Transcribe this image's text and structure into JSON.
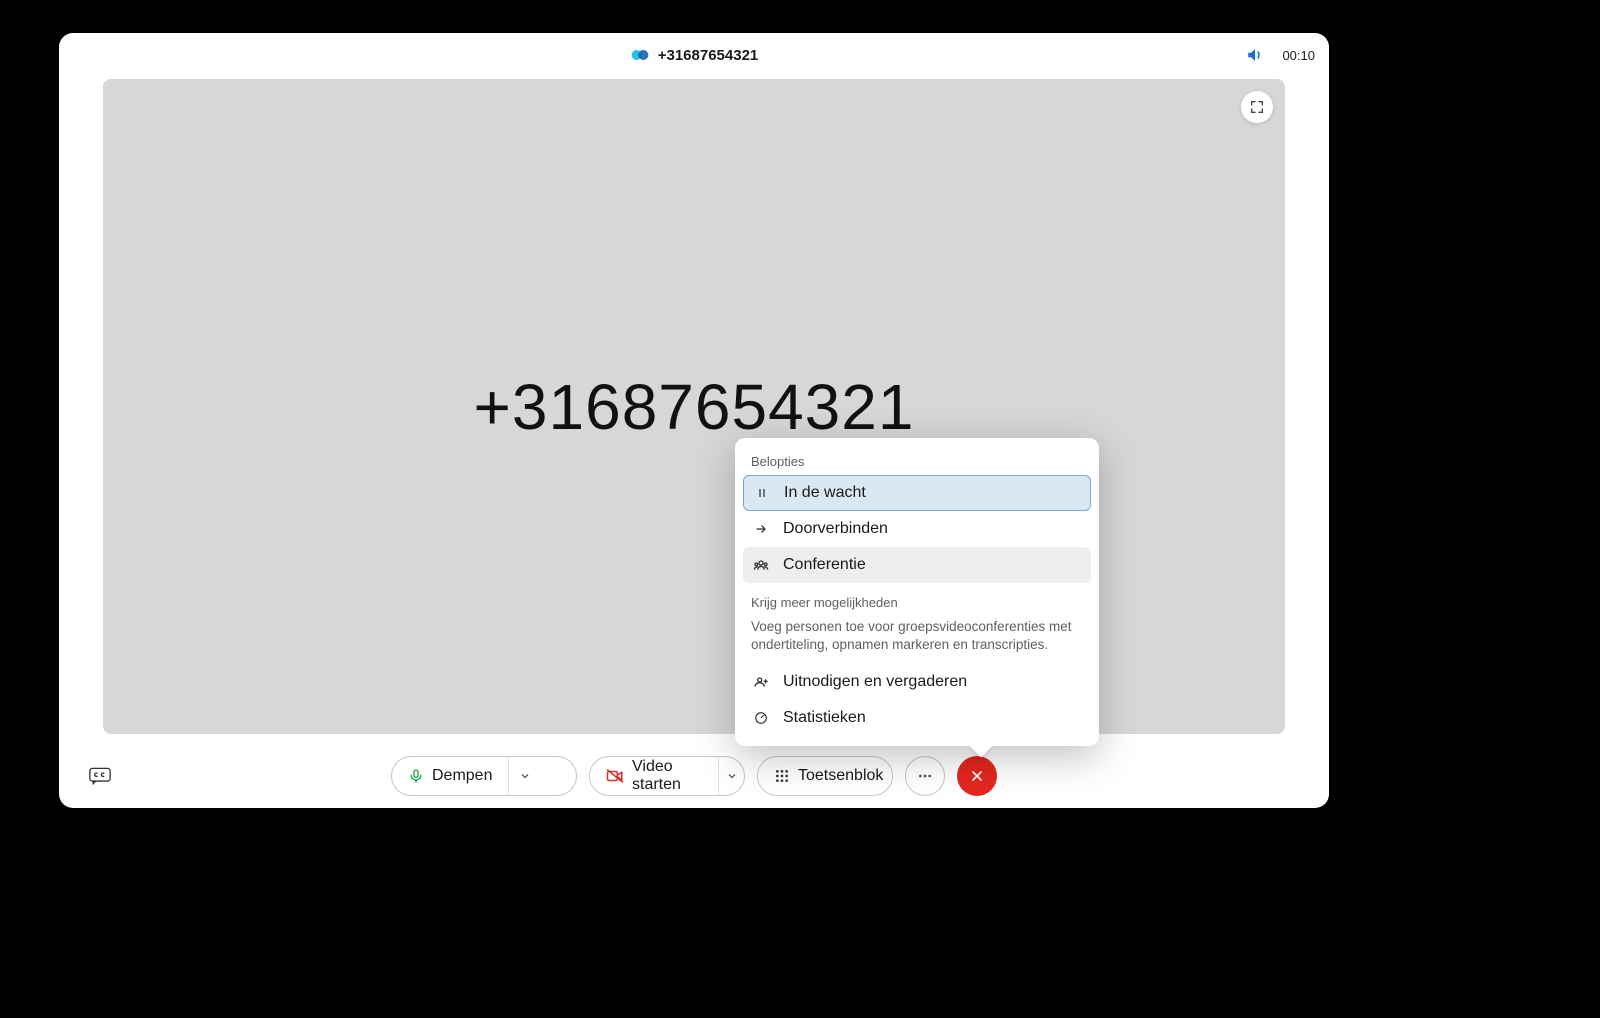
{
  "header": {
    "title": "+31687654321",
    "timer": "00:10"
  },
  "stage": {
    "caller_id": "+31687654321"
  },
  "toolbar": {
    "mute_label": "Dempen",
    "video_label": "Video starten",
    "keypad_label": "Toetsenblok"
  },
  "popover": {
    "section1_label": "Belopties",
    "hold_label": "In de wacht",
    "transfer_label": "Doorverbinden",
    "conference_label": "Conferentie",
    "section2_label": "Krijg meer mogelijkheden",
    "section2_body": "Voeg personen toe voor groepsvideoconferenties met ondertiteling, opnamen markeren en transcripties.",
    "invite_label": "Uitnodigen en vergaderen",
    "stats_label": "Statistieken"
  }
}
